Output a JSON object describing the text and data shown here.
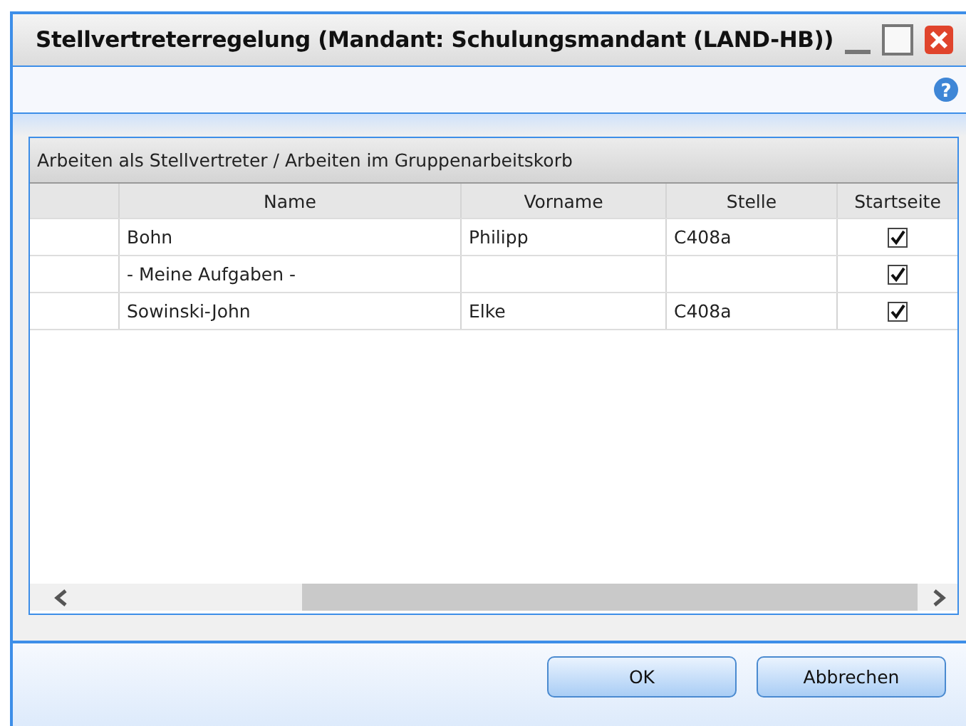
{
  "window": {
    "title": "Stellvertreterregelung (Mandant: Schulungsmandant (LAND-HB))"
  },
  "help": {
    "label": "?"
  },
  "panel": {
    "title": "Arbeiten als Stellvertreter / Arbeiten im Gruppenarbeitskorb"
  },
  "table": {
    "columns": [
      "Name",
      "Vorname",
      "Stelle",
      "Startseite"
    ],
    "rows": [
      {
        "name": "Bohn",
        "vorname": "Philipp",
        "stelle": "C408a",
        "startseite": true
      },
      {
        "name": "- Meine Aufgaben -",
        "startseite": true
      },
      {
        "name": "Sowinski-John",
        "vorname": "Elke",
        "stelle": "C408a",
        "startseite": true
      }
    ]
  },
  "buttons": [
    "OK",
    "Abbrechen"
  ]
}
